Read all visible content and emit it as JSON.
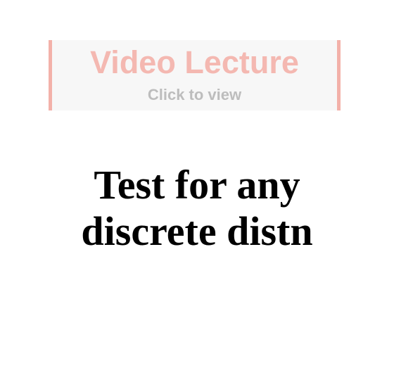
{
  "video_banner": {
    "title": "Video Lecture",
    "subtitle": "Click to view",
    "accent_color": "#f3b1a9",
    "title_color": "#f4b8b1",
    "subtitle_color": "#bdbdbd",
    "background_color": "#f7f7f7"
  },
  "slide": {
    "heading_line_1": "Test for any",
    "heading_line_2": "discrete distn"
  }
}
